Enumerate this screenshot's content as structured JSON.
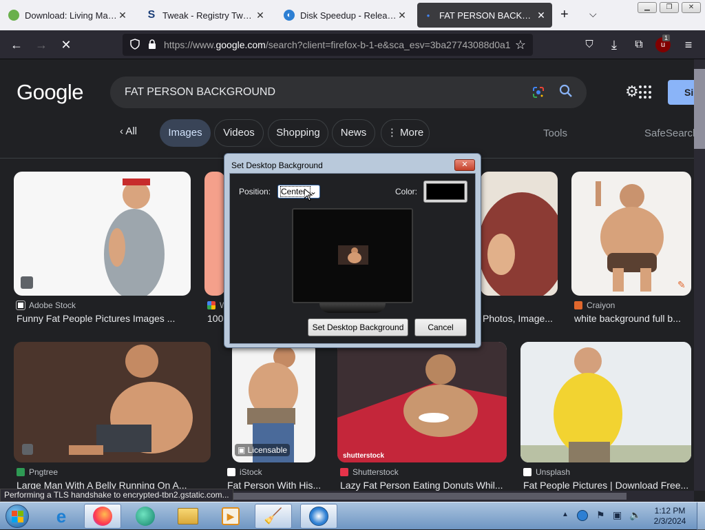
{
  "browser": {
    "tabs": [
      {
        "label": "Download: Living Marine A"
      },
      {
        "label": "Tweak - Registry Tweak Do"
      },
      {
        "label": "Disk Speedup - Release No"
      },
      {
        "label": "FAT PERSON BACKGROUNI"
      }
    ],
    "url_prefix": "https://www.",
    "url_domain": "google.com",
    "url_rest": "/search?client=firefox-b-1-e&sca_esv=3ba27743088d0a1",
    "extension_badge": "1"
  },
  "google": {
    "logo": "Google",
    "query": "FAT PERSON BACKGROUND",
    "signin_label": "Si",
    "back_label": "All",
    "tabs": [
      "Images",
      "Videos",
      "Shopping",
      "News",
      "More"
    ],
    "tools_label": "Tools",
    "safesearch_label": "SafeSearch",
    "results": [
      {
        "source": "Adobe Stock",
        "caption": "Funny Fat People Pictures Images ..."
      },
      {
        "source": "W",
        "caption": "100"
      },
      {
        "source": "",
        "caption": "Photos, Image..."
      },
      {
        "source": "Craiyon",
        "caption": "white background full b..."
      },
      {
        "source": "Pngtree",
        "caption": "Large Man With A Belly Running On A..."
      },
      {
        "source": "iStock",
        "caption": "Fat Person With His..."
      },
      {
        "source": "Shutterstock",
        "caption": "Lazy Fat Person Eating Donuts Whil..."
      },
      {
        "source": "Unsplash",
        "caption": "Fat People Pictures | Download Free..."
      }
    ],
    "licensable_label": "Licensable",
    "watermark_label": "shutterstock"
  },
  "dialog": {
    "title": "Set Desktop Background",
    "position_label": "Position:",
    "position_value": "Center",
    "color_label": "Color:",
    "color_value": "#000000",
    "set_button": "Set Desktop Background",
    "cancel_button": "Cancel"
  },
  "status_text": "Performing a TLS handshake to encrypted-tbn2.gstatic.com...",
  "taskbar": {
    "time": "1:12 PM",
    "date": "2/3/2024"
  }
}
